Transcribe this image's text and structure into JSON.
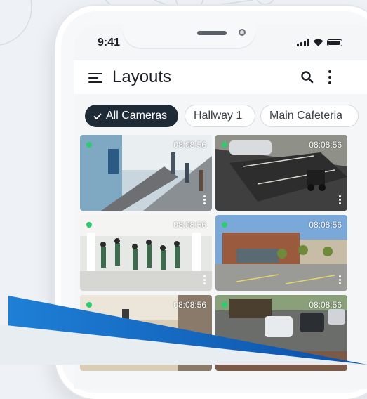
{
  "status_bar": {
    "time": "9:41"
  },
  "app_bar": {
    "title": "Layouts"
  },
  "chips": [
    {
      "label": "All Cameras",
      "selected": true
    },
    {
      "label": "Hallway 1",
      "selected": false
    },
    {
      "label": "Main Cafeteria",
      "selected": false
    }
  ],
  "cameras": [
    {
      "timestamp": "08:08:56"
    },
    {
      "timestamp": "08:08:56"
    },
    {
      "timestamp": "08:08:56"
    },
    {
      "timestamp": "08:08:56"
    },
    {
      "timestamp": "08:08:56"
    },
    {
      "timestamp": "08:08:56"
    }
  ],
  "colors": {
    "accent_dark": "#1f2a37",
    "live_indicator": "#2ecc71",
    "brand_blue": "#1976d2"
  }
}
